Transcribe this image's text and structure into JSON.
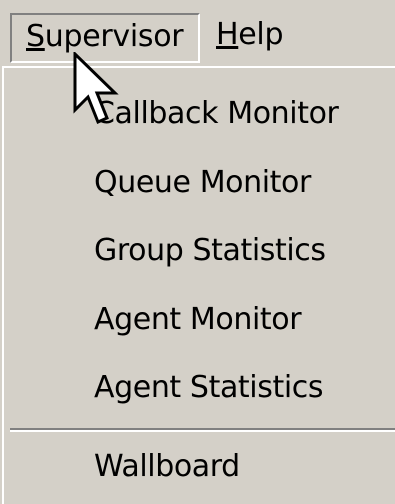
{
  "menubar": {
    "items": [
      {
        "label": "Supervisor",
        "mnemonic": "S",
        "rest": "upervisor",
        "state": "open"
      },
      {
        "label": "Help",
        "mnemonic": "H",
        "rest": "elp",
        "state": "normal"
      }
    ]
  },
  "dropdown": {
    "items": [
      {
        "label": "Callback Monitor"
      },
      {
        "label": "Queue Monitor"
      },
      {
        "label": "Group Statistics"
      },
      {
        "label": "Agent Monitor"
      },
      {
        "label": "Agent Statistics"
      },
      {
        "label": "Wallboard"
      }
    ]
  },
  "colors": {
    "menu_face": "#d4d0c8",
    "shadow": "#808080",
    "highlight": "#ffffff",
    "text": "#000000"
  },
  "cursor": {
    "icon": "arrow-pointer-icon"
  }
}
